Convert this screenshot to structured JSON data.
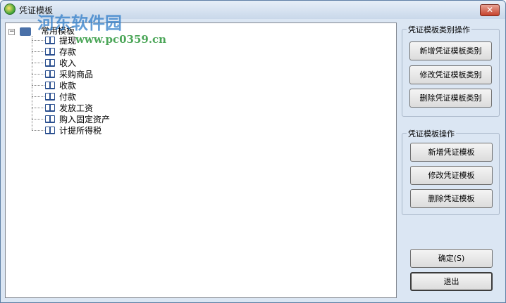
{
  "window": {
    "title": "凭证模板",
    "close_label": "✕"
  },
  "watermark": {
    "text": "河东软件园",
    "url": "www.pc0359.cn"
  },
  "tree": {
    "root": {
      "label": "常用模板",
      "expander": "−"
    },
    "children": [
      "提现",
      "存款",
      "收入",
      "采购商品",
      "收款",
      "付款",
      "发放工资",
      "购入固定资产",
      "计提所得税"
    ]
  },
  "category_group": {
    "title": "凭证模板类别操作",
    "add_label": "新增凭证模板类别",
    "edit_label": "修改凭证模板类别",
    "delete_label": "删除凭证模板类别"
  },
  "template_group": {
    "title": "凭证模板操作",
    "add_label": "新增凭证模板",
    "edit_label": "修改凭证模板",
    "delete_label": "删除凭证模板"
  },
  "footer": {
    "ok_label": "确定(S)",
    "exit_label": "退出"
  }
}
